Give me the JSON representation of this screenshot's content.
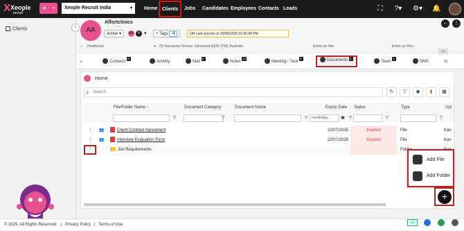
{
  "topbar": {
    "logo_main": "Xeople",
    "logo_sub": "recruit",
    "org_selector": "Xeople Recruit India",
    "nav": [
      "Home",
      "Clients",
      "Jobs",
      "Candidates",
      "Employees",
      "Contacts",
      "Leads"
    ],
    "active_nav": "Clients"
  },
  "sidebar": {
    "items": [
      {
        "label": "Clients"
      }
    ]
  },
  "header": {
    "avatar_initials": "AA",
    "company_name": "Affortclinics",
    "status": "Active",
    "mini_avatars": [
      "AM",
      "4"
    ],
    "tags_label": "+ Tags",
    "tags_value": "-4",
    "synced": "OH Last synced on 29/05/2025 01:45:49 PM",
    "info": {
      "industry": "Healthcare",
      "address": "29 Yancannia Terrace, Glenwood NSW 2768, Australia",
      "hire1": "Entire on Hire",
      "hire2": "Entire on Hire"
    }
  },
  "tabs": [
    {
      "label": "Contacts",
      "badge": "6"
    },
    {
      "label": "Activity",
      "badge": ""
    },
    {
      "label": "Mail",
      "badge": "0"
    },
    {
      "label": "Notes",
      "badge": "12"
    },
    {
      "label": "Meeting / Task",
      "badge": "0"
    },
    {
      "label": "Documents",
      "badge": "3"
    },
    {
      "label": "Team",
      "badge": "1"
    },
    {
      "label": "SMS",
      "badge": ""
    }
  ],
  "documents": {
    "breadcrumb": "Home",
    "search_placeholder": "Search",
    "columns": [
      "File/Folder Name",
      "Document Category",
      "Document Name",
      "Expiry Date",
      "Status",
      "Type",
      "Upl"
    ],
    "expiry_filter": "month/day...",
    "rows": [
      {
        "name": "Client Contract Agreement",
        "expiry": "22/07/2025",
        "status": "Expired",
        "type": "File",
        "upl": "Kan"
      },
      {
        "name": "Interview Evaluation Form",
        "expiry": "22/07/2025",
        "status": "Expired",
        "type": "File",
        "upl": "Kan"
      },
      {
        "name": "Job Requirements",
        "expiry": "",
        "status": "",
        "type": "Folder",
        "upl": "Kan"
      }
    ]
  },
  "popup": {
    "add_file": "Add File",
    "add_folder": "Add Folder"
  },
  "footer": {
    "copyright": "© 2025. All Rights Reserved",
    "privacy": "Privacy Policy",
    "terms": "Terms of Use",
    "qa_badge": "QA"
  }
}
